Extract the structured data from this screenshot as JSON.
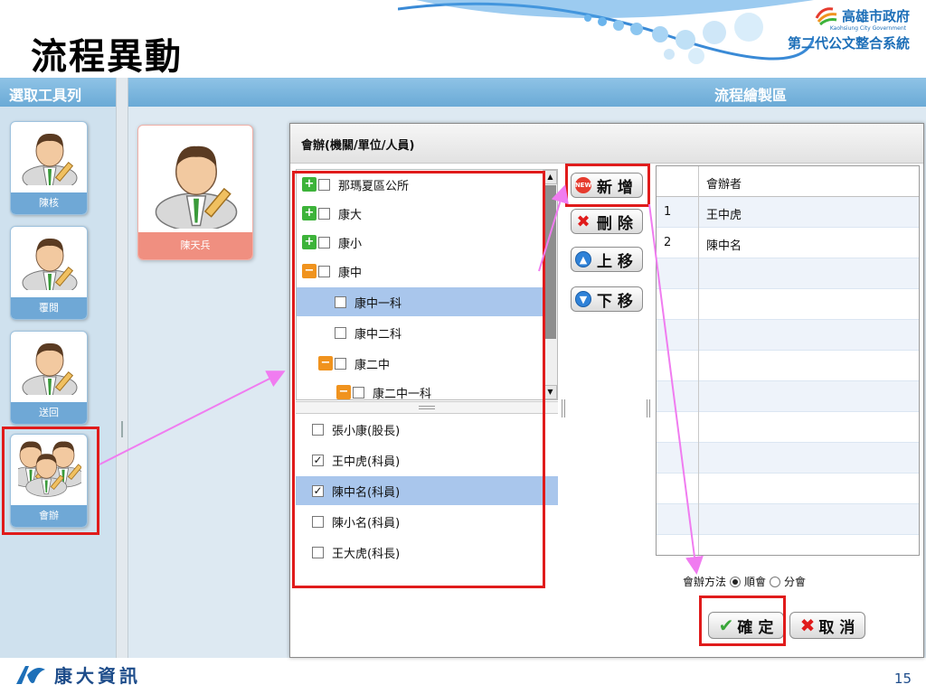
{
  "slide": {
    "title": "流程異動",
    "page_number": "15"
  },
  "logo": {
    "gov_name": "高雄市政府",
    "gov_en": "Kaohsiung City Government",
    "system_name": "第二代公文整合系統"
  },
  "company": {
    "name": "康大資訊"
  },
  "toolbar": {
    "title": "選取工具列",
    "tools": [
      {
        "label": "陳核"
      },
      {
        "label": "覆閱"
      },
      {
        "label": "送回"
      },
      {
        "label": "會辦"
      }
    ]
  },
  "canvas": {
    "title": "流程繪製區",
    "node": {
      "label": "陳天兵"
    }
  },
  "dialog": {
    "title": "會辦(機關/單位/人員)",
    "tree": [
      {
        "label": "那瑪夏區公所",
        "toggle": "plus",
        "indent": 0,
        "selected": false
      },
      {
        "label": "康大",
        "toggle": "plus",
        "indent": 0,
        "selected": false
      },
      {
        "label": "康小",
        "toggle": "plus",
        "indent": 0,
        "selected": false
      },
      {
        "label": "康中",
        "toggle": "minus",
        "indent": 0,
        "selected": false
      },
      {
        "label": "康中一科",
        "toggle": "",
        "indent": 1,
        "selected": true
      },
      {
        "label": "康中二科",
        "toggle": "",
        "indent": 1,
        "selected": false
      },
      {
        "label": "康二中",
        "toggle": "minus",
        "indent": 1,
        "selected": false
      },
      {
        "label": "康二中一科",
        "toggle": "minus",
        "indent": 2,
        "selected": false
      }
    ],
    "members": [
      {
        "label": "張小康(股長)",
        "checked": false,
        "selected": false
      },
      {
        "label": "王中虎(科員)",
        "checked": true,
        "selected": false
      },
      {
        "label": "陳中名(科員)",
        "checked": true,
        "selected": true
      },
      {
        "label": "陳小名(科員)",
        "checked": false,
        "selected": false
      },
      {
        "label": "王大虎(科長)",
        "checked": false,
        "selected": false
      }
    ],
    "buttons": {
      "add": "新 增",
      "delete": "刪 除",
      "move_up": "上 移",
      "move_down": "下 移",
      "add_icon_text": "NEW"
    },
    "grid": {
      "header_no": "",
      "header_name": "會辦者",
      "rows": [
        {
          "no": "1",
          "name": "王中虎"
        },
        {
          "no": "2",
          "name": "陳中名"
        }
      ]
    },
    "method": {
      "label": "會辦方法",
      "options": [
        "順會",
        "分會"
      ],
      "selected": "順會"
    },
    "confirm": "確 定",
    "cancel": "取 消"
  },
  "colors": {
    "highlight": "#e01b1b",
    "arrow": "#f07cf0",
    "header": "#7bb4dc",
    "selection": "#a9c6ec"
  }
}
